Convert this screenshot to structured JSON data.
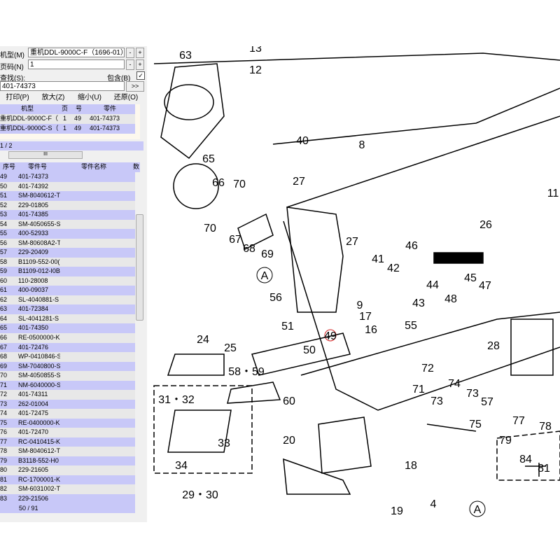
{
  "form": {
    "model_label": "机型(M)",
    "model_value": "重机DDL-9000C-F（1696-01）",
    "page_label": "页码(N)",
    "page_value": "1",
    "search_label": "查找(S):",
    "include_label": "包含(B)",
    "include_checked": true,
    "search_value": "401-74373",
    "go_label": ">>",
    "minus": "-",
    "plus": "+"
  },
  "toolbar": {
    "print": "打印(P)",
    "zoom_in": "放大(Z)",
    "zoom_out": "缩小(U)",
    "restore": "还原(O)"
  },
  "results": {
    "headers": [
      "机型",
      "页",
      "号",
      "零件"
    ],
    "rows": [
      [
        "重机DDL-9000C-F（",
        "1",
        "49",
        "401-74373"
      ],
      [
        "重机DDL-9000C-S（",
        "1",
        "49",
        "401-74373"
      ]
    ],
    "pager": "1 / 2",
    "scroll_mid": "III"
  },
  "parts": {
    "headers": [
      "序号",
      "零件号",
      "零件名称",
      "数"
    ],
    "rows": [
      [
        "49",
        "401-74373"
      ],
      [
        "50",
        "401-74392"
      ],
      [
        "51",
        "SM-8040612-T"
      ],
      [
        "52",
        "229-01805"
      ],
      [
        "53",
        "401-74385"
      ],
      [
        "54",
        "SM-4050655-S"
      ],
      [
        "55",
        "400-52933"
      ],
      [
        "56",
        "SM-80608A2-T"
      ],
      [
        "57",
        "229-20409"
      ],
      [
        "58",
        "B1109-552-00("
      ],
      [
        "59",
        "B1109-012-I0B"
      ],
      [
        "60",
        "110-28008"
      ],
      [
        "61",
        "400-09037"
      ],
      [
        "62",
        "SL-4040881-S"
      ],
      [
        "63",
        "401-72384"
      ],
      [
        "64",
        "SL-4041281-S"
      ],
      [
        "65",
        "401-74350"
      ],
      [
        "66",
        "RE-0500000-K"
      ],
      [
        "67",
        "401-72476"
      ],
      [
        "68",
        "WP-0410846-S"
      ],
      [
        "69",
        "SM-7040800-S"
      ],
      [
        "70",
        "SM-4050855-S"
      ],
      [
        "71",
        "NM-6040000-S"
      ],
      [
        "72",
        "401-74311"
      ],
      [
        "73",
        "262-01004"
      ],
      [
        "74",
        "401-72475"
      ],
      [
        "75",
        "RE-0400000-K"
      ],
      [
        "76",
        "401-72470"
      ],
      [
        "77",
        "RC-0410415-K"
      ],
      [
        "78",
        "SM-8040612-T"
      ],
      [
        "79",
        "B3118-552-H0"
      ],
      [
        "80",
        "229-21605"
      ],
      [
        "81",
        "RC-1700001-K"
      ],
      [
        "82",
        "SM-6031002-T"
      ],
      [
        "83",
        "229-21506"
      ]
    ],
    "footer": "50 / 91"
  },
  "diagram": {
    "highlight_color": "#d02020",
    "labels": [
      "63",
      "12",
      "13",
      "40",
      "8",
      "65",
      "66",
      "70",
      "70",
      "27",
      "27",
      "67",
      "68",
      "69",
      "26",
      "A",
      "46",
      "41",
      "42",
      "44",
      "45",
      "47",
      "48",
      "43",
      "56",
      "9",
      "17",
      "51",
      "16",
      "55",
      "49",
      "50",
      "28",
      "24",
      "25",
      "58・59",
      "72",
      "71",
      "74",
      "73",
      "73",
      "57",
      "75",
      "77",
      "78",
      "79",
      "84",
      "81",
      "31・32",
      "33",
      "34",
      "60",
      "20",
      "18",
      "29・30",
      "19",
      "4",
      "A",
      "11"
    ],
    "highlight": "49"
  }
}
